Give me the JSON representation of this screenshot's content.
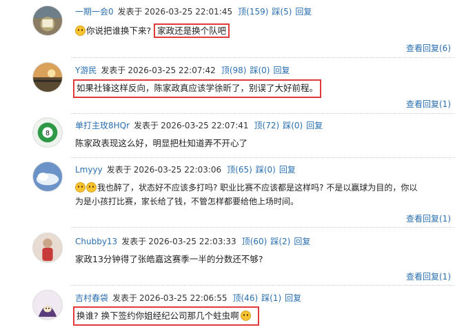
{
  "labels": {
    "posted": "发表于",
    "up_label": "顶",
    "down_label": "踩",
    "reply": "回复"
  },
  "comments": [
    {
      "user": "一期一会0",
      "time": "2026-03-25  22:01:45",
      "up": "(159)",
      "down": "(5)",
      "text": "你说把谁换下来?",
      "highlight": "家政还是换个队吧",
      "view_replies": "查看回复(6)"
    },
    {
      "user": "Y游民",
      "time": "2026-03-25  22:07:42",
      "up": "(98)",
      "down": "(0)",
      "text": "如果社锋这样反向，陈家政真应该学徐昕了，别误了大好前程。",
      "view_replies": "查看回复(1)"
    },
    {
      "user": "单打主玫8HQr",
      "time": "2026-03-25  22:07:41",
      "up": "(72)",
      "down": "(0)",
      "text": "陈家政表现这么好，明显把杜知道弄不开心了"
    },
    {
      "user": "Lmyyy",
      "time": "2026-03-25  22:03:06",
      "up": "(65)",
      "down": "(0)",
      "text_line1": "我也醉了，状态好不应该多打吗? 职业比赛不应该都是这样吗? 不是以赢球为目的，你以",
      "text_line2": "为是小孩打比赛，家长给了钱，不管怎样都要给他上场时间。",
      "view_replies": "查看回复(1)"
    },
    {
      "user": "Chubby13",
      "time": "2026-03-25  22:03:33",
      "up": "(60)",
      "down": "(2)",
      "text": "家政13分钟得了张皓嘉这赛季一半的分数还不够?",
      "view_replies": "查看回复(1)"
    },
    {
      "user": "吉村春袋",
      "time": "2026-03-25  22:06:55",
      "up": "(46)",
      "down": "(1)",
      "text": "换谁? 换下签约你姐经纪公司那几个蛀虫啊"
    }
  ],
  "colors": {
    "link": "#2a6fb0",
    "highlight_border": "#e23a3a",
    "text": "#222222"
  }
}
